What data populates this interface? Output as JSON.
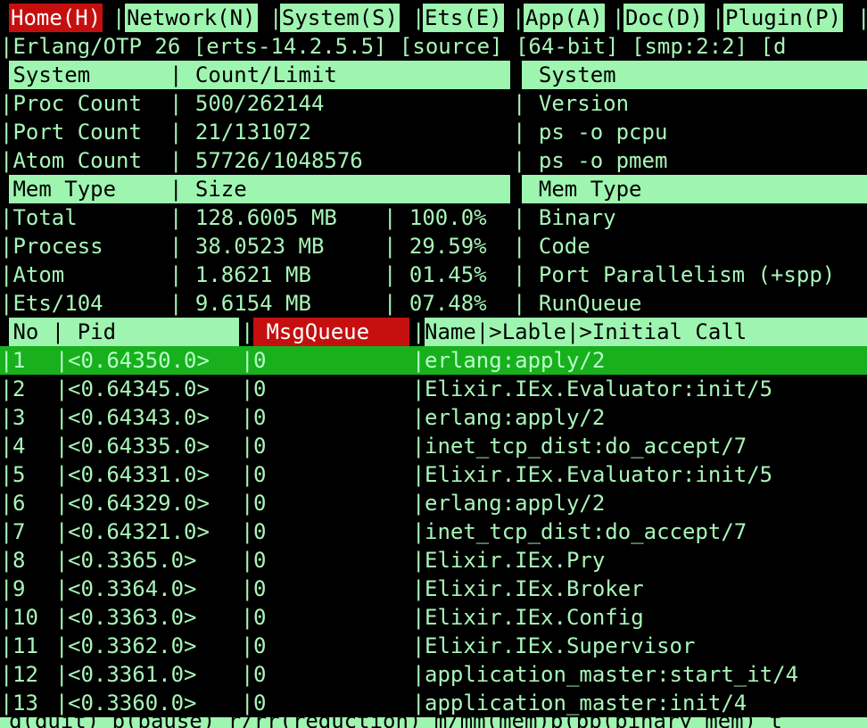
{
  "tabs": [
    {
      "label": "Home(H)",
      "active": true
    },
    {
      "label": "Network(N)",
      "active": false
    },
    {
      "label": "System(S)",
      "active": false
    },
    {
      "label": "Ets(E)",
      "active": false
    },
    {
      "label": "App(A)",
      "active": false
    },
    {
      "label": "Doc(D)",
      "active": false
    },
    {
      "label": "Plugin(P)",
      "active": false
    }
  ],
  "banner": "|Erlang/OTP 26 [erts-14.2.5.5] [source] [64-bit] [smp:2:2] [d",
  "system_header": {
    "c1": "|System",
    "c2": "| Count/Limit",
    "c3": "| System"
  },
  "system_rows": [
    {
      "c1": "|Proc Count",
      "c2": "| 500/262144",
      "c3": "| Version"
    },
    {
      "c1": "|Port Count",
      "c2": "| 21/131072",
      "c3": "| ps -o pcpu"
    },
    {
      "c1": "|Atom Count",
      "c2": "| 57726/1048576",
      "c3": "| ps -o pmem"
    }
  ],
  "mem_header": {
    "c1": "|Mem Type",
    "c2": "| Size",
    "c3": "| Mem Type"
  },
  "mem_rows": [
    {
      "c1": "|Total",
      "c2": "| 128.6005 MB",
      "c3": "| 100.0%",
      "c4": "| Binary"
    },
    {
      "c1": "|Process",
      "c2": "| 38.0523 MB",
      "c3": "| 29.59%",
      "c4": "| Code"
    },
    {
      "c1": "|Atom",
      "c2": "| 1.8621 MB",
      "c3": "| 01.45%",
      "c4": "| Port Parallelism (+spp)"
    },
    {
      "c1": "|Ets/104",
      "c2": "| 9.6154 MB",
      "c3": "| 07.48%",
      "c4": "| RunQueue"
    }
  ],
  "proc_header": {
    "no": "|No | Pid",
    "msgqueue": " MsgQueue ",
    "rest": "Name|>Lable|>Initial Call"
  },
  "proc_rows": [
    {
      "no": "1",
      "pid": "<0.64350.0>",
      "mq": "0",
      "call": "erlang:apply/2",
      "selected": true
    },
    {
      "no": "2",
      "pid": "<0.64345.0>",
      "mq": "0",
      "call": "Elixir.IEx.Evaluator:init/5",
      "selected": false
    },
    {
      "no": "3",
      "pid": "<0.64343.0>",
      "mq": "0",
      "call": "erlang:apply/2",
      "selected": false
    },
    {
      "no": "4",
      "pid": "<0.64335.0>",
      "mq": "0",
      "call": "inet_tcp_dist:do_accept/7",
      "selected": false
    },
    {
      "no": "5",
      "pid": "<0.64331.0>",
      "mq": "0",
      "call": "Elixir.IEx.Evaluator:init/5",
      "selected": false
    },
    {
      "no": "6",
      "pid": "<0.64329.0>",
      "mq": "0",
      "call": "erlang:apply/2",
      "selected": false
    },
    {
      "no": "7",
      "pid": "<0.64321.0>",
      "mq": "0",
      "call": "inet_tcp_dist:do_accept/7",
      "selected": false
    },
    {
      "no": "8",
      "pid": "<0.3365.0>",
      "mq": "0",
      "call": "Elixir.IEx.Pry",
      "selected": false
    },
    {
      "no": "9",
      "pid": "<0.3364.0>",
      "mq": "0",
      "call": "Elixir.IEx.Broker",
      "selected": false
    },
    {
      "no": "10",
      "pid": "<0.3363.0>",
      "mq": "0",
      "call": "Elixir.IEx.Config",
      "selected": false
    },
    {
      "no": "11",
      "pid": "<0.3362.0>",
      "mq": "0",
      "call": "Elixir.IEx.Supervisor",
      "selected": false
    },
    {
      "no": "12",
      "pid": "<0.3361.0>",
      "mq": "0",
      "call": "application_master:start_it/4",
      "selected": false
    },
    {
      "no": "13",
      "pid": "<0.3360.0>",
      "mq": "0",
      "call": "application_master:init/4",
      "selected": false
    }
  ],
  "footer": "q(quit) p(pause) r/rr(reduction) m/mm(mem)b(bb(binary mem) t",
  "colors": {
    "header_green": "#9ef5b0",
    "text_green": "#a8f5b8",
    "active_red": "#c50f0f",
    "selected_green": "#18b01d"
  }
}
